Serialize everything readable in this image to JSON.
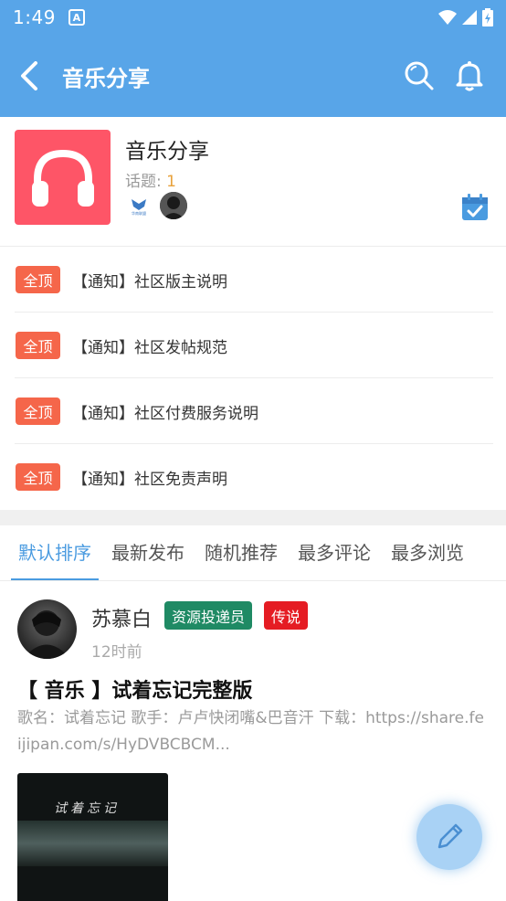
{
  "status_bar": {
    "time": "1:49",
    "notif_icon_letter": "A"
  },
  "app_bar": {
    "title": "音乐分享"
  },
  "forum": {
    "name": "音乐分享",
    "topics_label": "话题:",
    "topics_count": "1",
    "mod_logo_text": "华南联盟"
  },
  "notices": [
    {
      "tag": "全顶",
      "text": "【通知】社区版主说明"
    },
    {
      "tag": "全顶",
      "text": "【通知】社区发帖规范"
    },
    {
      "tag": "全顶",
      "text": "【通知】社区付费服务说明"
    },
    {
      "tag": "全顶",
      "text": "【通知】社区免责声明"
    }
  ],
  "tabs": [
    {
      "label": "默认排序",
      "active": true
    },
    {
      "label": "最新发布",
      "active": false
    },
    {
      "label": "随机推荐",
      "active": false
    },
    {
      "label": "最多评论",
      "active": false
    },
    {
      "label": "最多浏览",
      "active": false
    }
  ],
  "post": {
    "author": "苏慕白",
    "badge_role": "资源投递员",
    "badge_level": "传说",
    "time": "12时前",
    "title": "【 音乐 】试着忘记完整版",
    "body": "歌名：试着忘记 歌手：卢卢快闭嘴&巴音汗 下载：https://share.feijipan.com/s/HyDVBCBCM...",
    "thumb_text": "试着忘记"
  },
  "colors": {
    "primary": "#58a5e8",
    "accent_tab": "#4a9be0",
    "tag_top": "#f5664a",
    "forum_logo": "#fe5567",
    "badge_green": "#1f8a64",
    "badge_red": "#e51c23"
  }
}
